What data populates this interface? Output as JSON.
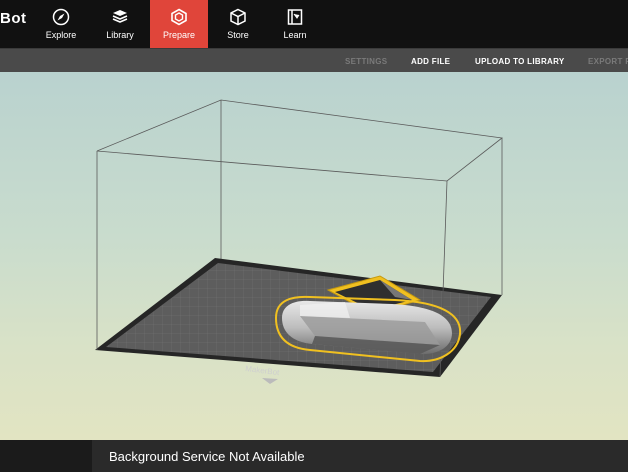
{
  "app": {
    "logo_text": "Bot"
  },
  "nav": {
    "tabs": [
      {
        "label": "Explore",
        "icon": "compass-icon",
        "active": false
      },
      {
        "label": "Library",
        "icon": "library-icon",
        "active": false
      },
      {
        "label": "Prepare",
        "icon": "prepare-cube-icon",
        "active": true
      },
      {
        "label": "Store",
        "icon": "store-box-icon",
        "active": false
      },
      {
        "label": "Learn",
        "icon": "learn-book-icon",
        "active": false
      }
    ]
  },
  "toolbar": {
    "settings": "SETTINGS",
    "add_file": "ADD FILE",
    "upload": "UPLOAD TO LIBRARY",
    "export": "EXPORT P"
  },
  "build_plate": {
    "brand": "MakerBot"
  },
  "status": {
    "message": "Background Service Not Available"
  },
  "colors": {
    "accent": "#e0453a",
    "selection": "#f0c020"
  }
}
